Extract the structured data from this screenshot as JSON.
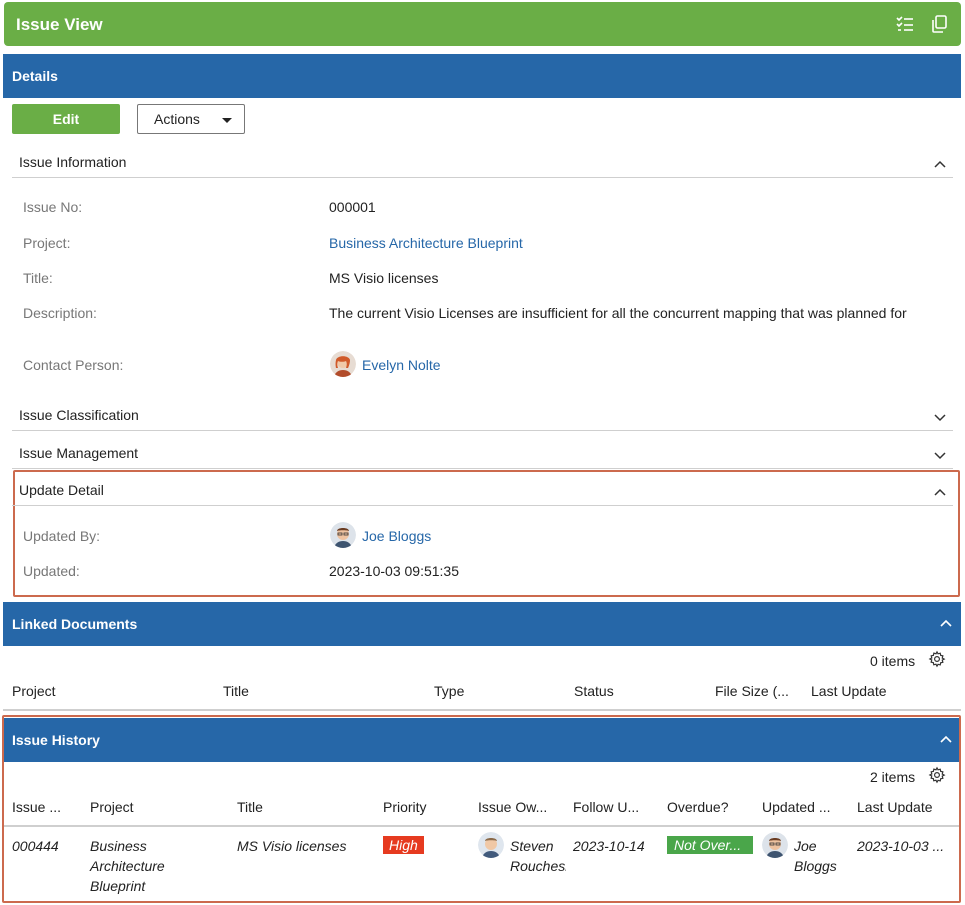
{
  "top_bar": {
    "title": "Issue View",
    "icons": [
      "checklist-icon",
      "copy-icon"
    ]
  },
  "details": {
    "header": "Details",
    "edit_label": "Edit",
    "actions_label": "Actions",
    "issue_information": {
      "title": "Issue Information",
      "fields": [
        {
          "label": "Issue No:",
          "value": "000001"
        },
        {
          "label": "Project:",
          "value": "Business Architecture Blueprint"
        },
        {
          "label": "Title:",
          "value": "MS Visio licenses"
        },
        {
          "label": "Description:",
          "value": "The current Visio Licenses are insufficient for all the concurrent mapping that was planned for"
        },
        {
          "label": "Contact Person:",
          "value": "Evelyn Nolte"
        }
      ]
    },
    "issue_classification": {
      "title": "Issue Classification"
    },
    "issue_management": {
      "title": "Issue Management"
    },
    "update_detail": {
      "title": "Update Detail",
      "fields": [
        {
          "label": "Updated By:",
          "value": "Joe Bloggs"
        },
        {
          "label": "Updated:",
          "value": "2023-10-03 09:51:35"
        }
      ]
    }
  },
  "linked_documents": {
    "header": "Linked Documents",
    "count": "0 items",
    "columns": [
      "Project",
      "Title",
      "Type",
      "Status",
      "File Size (...",
      "Last Update"
    ]
  },
  "issue_history": {
    "header": "Issue History",
    "count": "2 items",
    "columns": [
      "Issue ...",
      "Project",
      "Title",
      "Priority",
      "Issue Ow...",
      "Follow U...",
      "Overdue?",
      "Updated ...",
      "Last Update"
    ],
    "rows": [
      {
        "issue_no": "000444",
        "project_lines": [
          "Business",
          "Architecture",
          "Blueprint"
        ],
        "title": "MS Visio licenses",
        "priority": "High",
        "owner_lines": [
          "Steven",
          "Rouchesi"
        ],
        "follow_up": "2023-10-14",
        "overdue": "Not Over...",
        "updated_by_lines": [
          "Joe",
          "Bloggs"
        ],
        "last_update": "2023-10-03 ..."
      }
    ]
  },
  "colors": {
    "green": "#6aae46",
    "blue": "#2667a8",
    "high": "#e63a20",
    "ok": "#4aa64a",
    "highlight": "#cc6a4e"
  }
}
